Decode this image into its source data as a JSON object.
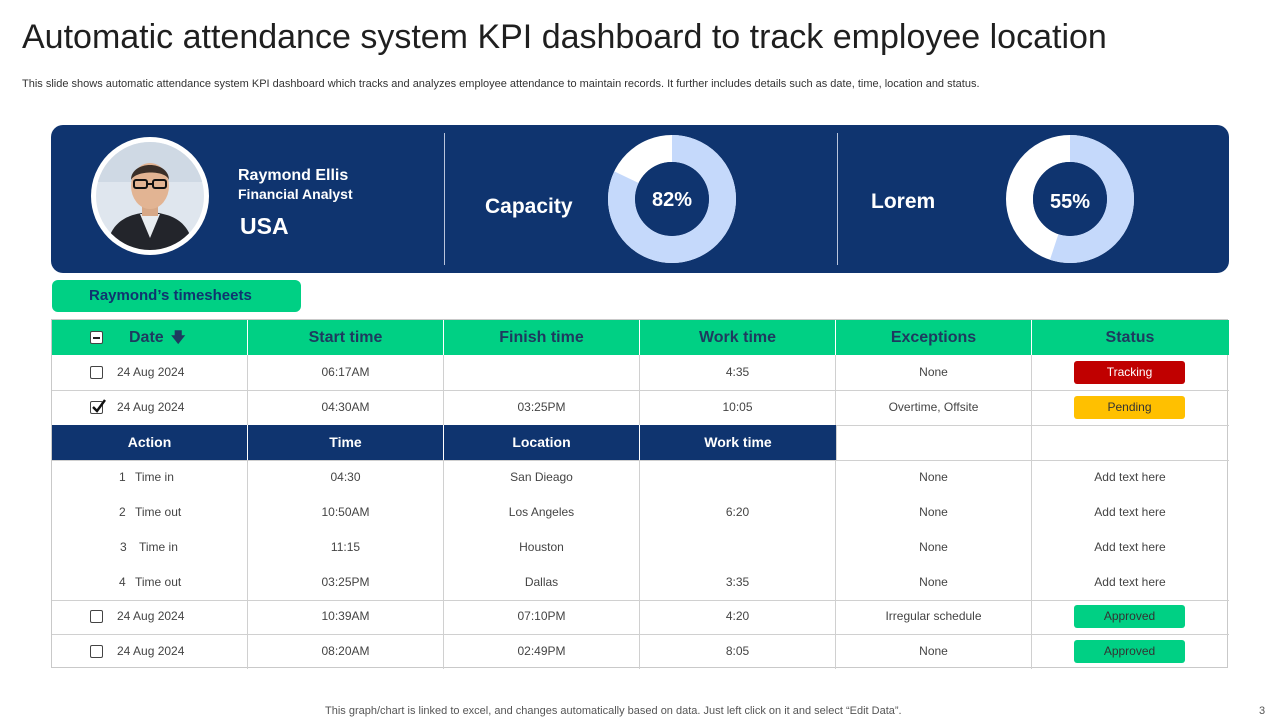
{
  "title": "Automatic attendance system KPI dashboard to track employee location",
  "subtitle": "This slide shows automatic attendance system KPI dashboard which tracks and analyzes employee attendance to maintain records. It further includes details such as date, time, location and status.",
  "profile": {
    "name": "Raymond Ellis",
    "role": "Financial Analyst",
    "country": "USA"
  },
  "kpis": [
    {
      "label": "Capacity",
      "value": 82,
      "value_text": "82%"
    },
    {
      "label": "Lorem",
      "value": 55,
      "value_text": "55%"
    }
  ],
  "colors": {
    "banner": "#0f346f",
    "accent_green": "#00d084",
    "donut_fill": "#c5d9fb",
    "tracking": "#c00000",
    "pending": "#ffc000",
    "approved": "#00d084"
  },
  "timesheet_tab": "Raymond’s timesheets",
  "table": {
    "headers": [
      "Date",
      "Start time",
      "Finish time",
      "Work time",
      "Exceptions",
      "Status"
    ],
    "sort_icon": "arrow-down-icon",
    "rows_top": [
      {
        "checked": false,
        "date": "24 Aug 2024",
        "start": "06:17AM",
        "finish": "",
        "work": "4:35",
        "exceptions": "None",
        "status": "Tracking"
      },
      {
        "checked": true,
        "date": "24 Aug 2024",
        "start": "04:30AM",
        "finish": "03:25PM",
        "work": "10:05",
        "exceptions": "Overtime, Offsite",
        "status": "Pending"
      }
    ],
    "sub_headers": [
      "Action",
      "Time",
      "Location",
      "Work time"
    ],
    "sub_rows": [
      {
        "num": "1",
        "action": "Time in",
        "time": "04:30",
        "location": "San Dieago",
        "work": "",
        "exceptions": "None",
        "note": "Add text here"
      },
      {
        "num": "2",
        "action": "Time out",
        "time": "10:50AM",
        "location": "Los Angeles",
        "work": "6:20",
        "exceptions": "None",
        "note": "Add text here"
      },
      {
        "num": "3",
        "action": "Time in",
        "time": "11:15",
        "location": "Houston",
        "work": "",
        "exceptions": "None",
        "note": "Add text here"
      },
      {
        "num": "4",
        "action": "Time out",
        "time": "03:25PM",
        "location": "Dallas",
        "work": "3:35",
        "exceptions": "None",
        "note": "Add text here"
      }
    ],
    "rows_bottom": [
      {
        "checked": false,
        "date": "24 Aug 2024",
        "start": "10:39AM",
        "finish": "07:10PM",
        "work": "4:20",
        "exceptions": "Irregular schedule",
        "status": "Approved"
      },
      {
        "checked": false,
        "date": "24 Aug 2024",
        "start": "08:20AM",
        "finish": "02:49PM",
        "work": "8:05",
        "exceptions": "None",
        "status": "Approved"
      }
    ]
  },
  "footer": "This graph/chart is linked to excel,  and changes automatically based on data. Just left click on it and select “Edit Data”.",
  "page_number": "3"
}
